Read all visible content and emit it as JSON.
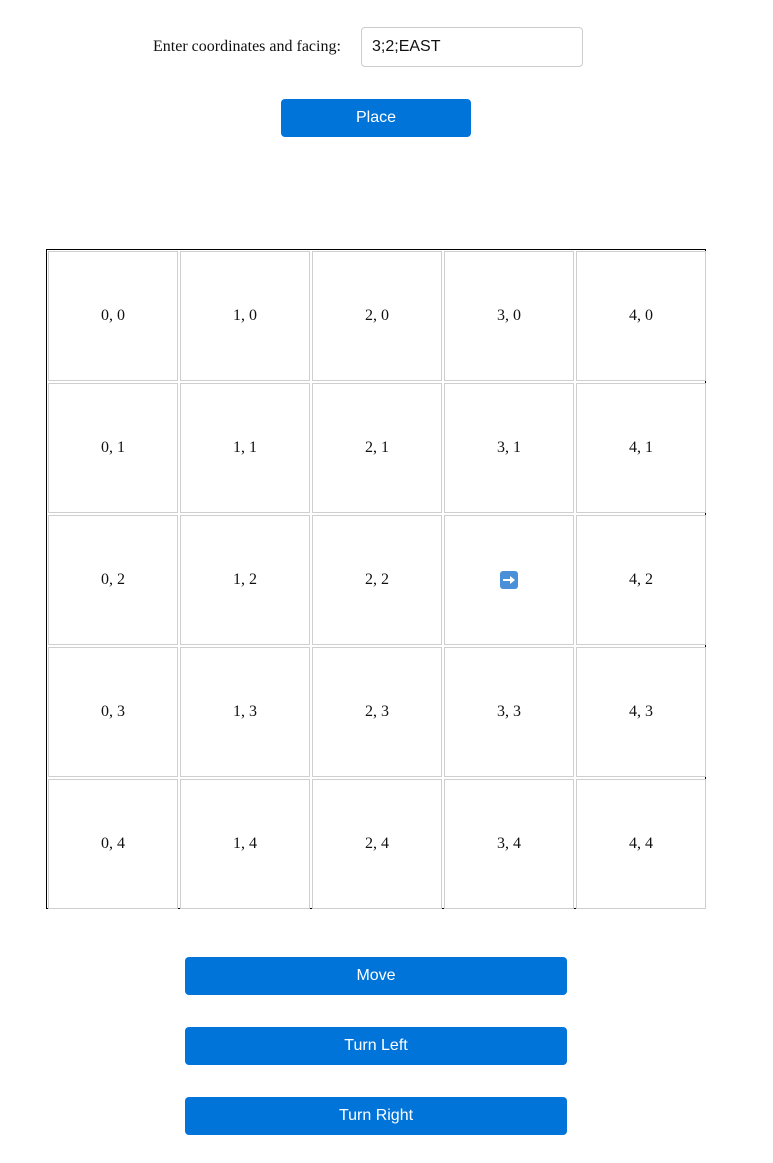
{
  "form": {
    "label": "Enter coordinates and facing:",
    "input_value": "3;2;EAST",
    "place_label": "Place"
  },
  "grid": {
    "columns": 5,
    "rows": 5,
    "robot": {
      "x": 3,
      "y": 2,
      "facing": "EAST",
      "icon": "right-arrow-icon"
    },
    "cells": [
      [
        "0, 0",
        "1, 0",
        "2, 0",
        "3, 0",
        "4, 0"
      ],
      [
        "0, 1",
        "1, 1",
        "2, 1",
        "3, 1",
        "4, 1"
      ],
      [
        "0, 2",
        "1, 2",
        "2, 2",
        "",
        "4, 2"
      ],
      [
        "0, 3",
        "1, 3",
        "2, 3",
        "3, 3",
        "4, 3"
      ],
      [
        "0, 4",
        "1, 4",
        "2, 4",
        "3, 4",
        "4, 4"
      ]
    ]
  },
  "controls": {
    "move_label": "Move",
    "turn_left_label": "Turn Left",
    "turn_right_label": "Turn Right"
  },
  "colors": {
    "button_bg": "#0074d9",
    "button_text": "#ffffff",
    "robot_icon_bg": "#4a90d9"
  }
}
